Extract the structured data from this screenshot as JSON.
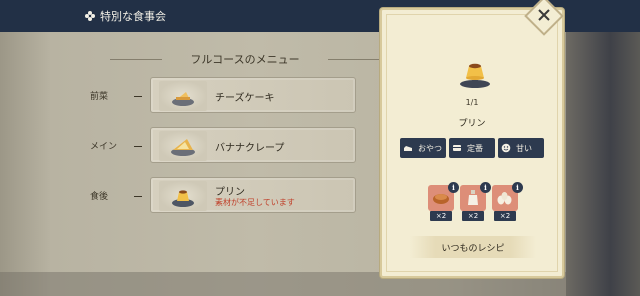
{
  "scene": {
    "title": "特別な食事会",
    "icon": "flower-icon"
  },
  "menu": {
    "header": "フルコースのメニュー",
    "courses": [
      {
        "label": "前菜",
        "dish": "チーズケーキ",
        "warning": ""
      },
      {
        "label": "メイン",
        "dish": "バナナクレープ",
        "warning": ""
      },
      {
        "label": "食後",
        "dish": "プリン",
        "warning": "素材が不足しています"
      }
    ]
  },
  "detail": {
    "count": "1/1",
    "dish": "プリン",
    "tags": [
      {
        "icon": "cake-icon",
        "label": "おやつ"
      },
      {
        "icon": "bowl-icon",
        "label": "定番"
      },
      {
        "icon": "smile-icon",
        "label": "甘い"
      }
    ],
    "ingredients": [
      {
        "icon": "bread-icon",
        "info": "i",
        "qty": "×2"
      },
      {
        "icon": "milk-bottle-icon",
        "info": "i",
        "qty": "×2"
      },
      {
        "icon": "eggs-icon",
        "info": "i",
        "qty": "×2"
      }
    ],
    "recipe_button": "いつものレシピ",
    "close_icon": "close-icon"
  },
  "colors": {
    "warning": "#c0402a",
    "tag_bg": "#2d3a4f",
    "ingredient_bg": "#dd8e78",
    "panel_bg": "#f3edd3"
  }
}
